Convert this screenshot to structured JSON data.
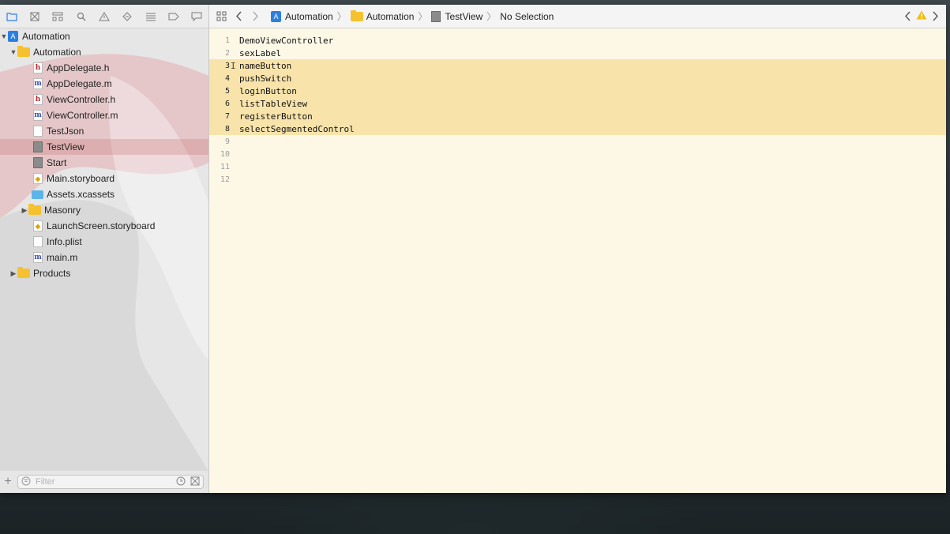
{
  "navigator": {
    "toolbar_icons": [
      "folder-icon",
      "source-control-icon",
      "hierarchy-icon",
      "search-icon",
      "issue-warning-icon",
      "test-diamond-icon",
      "debug-icon",
      "breakpoint-icon",
      "report-icon"
    ],
    "tree": [
      {
        "label": "Automation",
        "level": 0,
        "icon": "project",
        "disclosure": "open"
      },
      {
        "label": "Automation",
        "level": 1,
        "icon": "folder",
        "disclosure": "open"
      },
      {
        "label": "AppDelegate.h",
        "level": 2,
        "icon": "h"
      },
      {
        "label": "AppDelegate.m",
        "level": 2,
        "icon": "m"
      },
      {
        "label": "ViewController.h",
        "level": 2,
        "icon": "h"
      },
      {
        "label": "ViewController.m",
        "level": 2,
        "icon": "m"
      },
      {
        "label": "TestJson",
        "level": 2,
        "icon": "doc"
      },
      {
        "label": "TestView",
        "level": 2,
        "icon": "gray",
        "selected": true
      },
      {
        "label": "Start",
        "level": 2,
        "icon": "gray"
      },
      {
        "label": "Main.storyboard",
        "level": 2,
        "icon": "storyboard"
      },
      {
        "label": "Assets.xcassets",
        "level": 2,
        "icon": "assets"
      },
      {
        "label": "Masonry",
        "level": 2,
        "icon": "folder",
        "disclosure": "closed"
      },
      {
        "label": "LaunchScreen.storyboard",
        "level": 2,
        "icon": "storyboard"
      },
      {
        "label": "Info.plist",
        "level": 2,
        "icon": "doc"
      },
      {
        "label": "main.m",
        "level": 2,
        "icon": "m"
      },
      {
        "label": "Products",
        "level": 1,
        "icon": "folder",
        "disclosure": "closed"
      }
    ],
    "filter_placeholder": "Filter"
  },
  "jumpbar": {
    "crumbs": [
      {
        "label": "Automation",
        "icon": "project"
      },
      {
        "label": "Automation",
        "icon": "folder"
      },
      {
        "label": "TestView",
        "icon": "doc"
      },
      {
        "label": "No Selection",
        "icon": ""
      }
    ]
  },
  "editor": {
    "lines": [
      {
        "num": "1",
        "text": "DemoViewController",
        "highlight": false
      },
      {
        "num": "2",
        "text": "sexLabel",
        "highlight": false
      },
      {
        "num": "3",
        "text": "nameButton",
        "highlight": true
      },
      {
        "num": "4",
        "text": "pushSwitch",
        "highlight": true
      },
      {
        "num": "5",
        "text": "loginButton",
        "highlight": true
      },
      {
        "num": "6",
        "text": "listTableView",
        "highlight": true
      },
      {
        "num": "7",
        "text": "registerButton",
        "highlight": true
      },
      {
        "num": "8",
        "text": "selectSegmentedControl",
        "highlight": true
      },
      {
        "num": "9",
        "text": "",
        "highlight": false
      },
      {
        "num": "10",
        "text": "",
        "highlight": false
      },
      {
        "num": "11",
        "text": "",
        "highlight": false
      },
      {
        "num": "12",
        "text": "",
        "highlight": false
      }
    ]
  },
  "colors": {
    "selection": "#e2b8b4",
    "highlight": "#f8e4ab",
    "editor_bg": "#fdf8e6",
    "accent": "#2a7ef4"
  }
}
